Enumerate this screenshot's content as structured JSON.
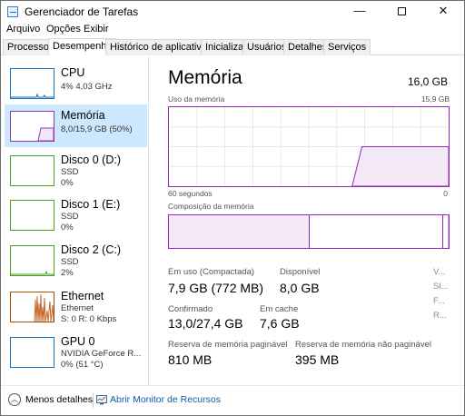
{
  "window": {
    "title": "Gerenciador de Tarefas",
    "minimize_glyph": "—",
    "close_glyph": "✕"
  },
  "menu": [
    "Arquivo",
    "Opções",
    "Exibir"
  ],
  "tabs": [
    "Processos",
    "Desempenho",
    "Histórico de aplicativos",
    "Inicializar",
    "Usuários",
    "Detalhes",
    "Serviços"
  ],
  "active_tab": "Desempenho",
  "sidebar": {
    "items": [
      {
        "name": "CPU",
        "sub1": "4% 4,03 GHz",
        "sub2": "",
        "sub3": "",
        "color": "#1170c0",
        "icon": "cpu-graph-icon"
      },
      {
        "name": "Memória",
        "sub1": "8,0/15,9 GB (50%)",
        "sub2": "",
        "sub3": "",
        "color": "#8b3ab5",
        "icon": "memory-graph-icon",
        "active": true
      },
      {
        "name": "Disco 0 (D:)",
        "sub1": "SSD",
        "sub2": "0%",
        "sub3": "",
        "color": "#4aa022",
        "icon": "disk-graph-icon"
      },
      {
        "name": "Disco 1 (E:)",
        "sub1": "SSD",
        "sub2": "0%",
        "sub3": "",
        "color": "#4aa022",
        "icon": "disk-graph-icon"
      },
      {
        "name": "Disco 2 (C:)",
        "sub1": "SSD",
        "sub2": "2%",
        "sub3": "",
        "color": "#4aa022",
        "icon": "disk-graph-icon"
      },
      {
        "name": "Ethernet",
        "sub1": "Ethernet",
        "sub2": "S: 0 R: 0 Kbps",
        "sub3": "",
        "color": "#a74f00",
        "icon": "ethernet-graph-icon"
      },
      {
        "name": "GPU 0",
        "sub1": "NVIDIA GeForce R...",
        "sub2": "0% (51 °C)",
        "sub3": "",
        "color": "#1170c0",
        "icon": "gpu-graph-icon"
      }
    ]
  },
  "main": {
    "title": "Memória",
    "total": "16,0 GB",
    "usage_label": "Uso da memória",
    "usage_max": "15,9 GB",
    "time_left": "60 segundos",
    "time_right": "0",
    "composition_label": "Composição da memória",
    "usage_fraction": 0.5,
    "stats": {
      "in_use_label": "Em uso (Compactada)",
      "in_use_value": "7,9 GB (772 MB)",
      "available_label": "Disponível",
      "available_value": "8,0 GB",
      "committed_label": "Confirmado",
      "committed_value": "13,0/27,4 GB",
      "cached_label": "Em cache",
      "cached_value": "7,6 GB",
      "paged_label": "Reserva de memória paginável",
      "paged_value": "810 MB",
      "nonpaged_label": "Reserva de memória não paginável",
      "nonpaged_value": "395 MB",
      "cut_labels": [
        "V...",
        "Sl...",
        "F...",
        "R..."
      ]
    }
  },
  "bottom": {
    "fewer_details": "Menos detalhes",
    "open_monitor": "Abrir Monitor de Recursos"
  },
  "colors": {
    "memory": "#9528b4",
    "memory_fill": "#f4eaf7",
    "selected": "#cce8ff",
    "link": "#0b5ea8"
  }
}
